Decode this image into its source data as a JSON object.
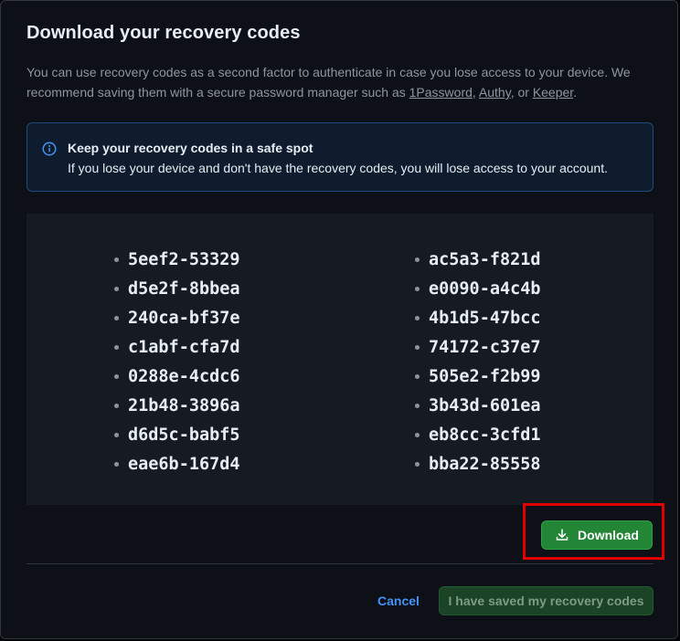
{
  "dialog": {
    "title": "Download your recovery codes",
    "description_part1": "You can use recovery codes as a second factor to authenticate in case you lose access to your device. We recommend saving them with a secure password manager such as ",
    "links": [
      "1Password",
      "Authy",
      "Keeper"
    ],
    "sep1": ", ",
    "sep2": ", or ",
    "end": "."
  },
  "flash": {
    "icon": "info-icon",
    "title": "Keep your recovery codes in a safe spot",
    "text": "If you lose your device and don't have the recovery codes, you will lose access to your account."
  },
  "codes": {
    "left": [
      "5eef2-53329",
      "d5e2f-8bbea",
      "240ca-bf37e",
      "c1abf-cfa7d",
      "0288e-4cdc6",
      "21b48-3896a",
      "d6d5c-babf5",
      "eae6b-167d4"
    ],
    "right": [
      "ac5a3-f821d",
      "e0090-a4c4b",
      "4b1d5-47bcc",
      "74172-c37e7",
      "505e2-f2b99",
      "3b43d-601ea",
      "eb8cc-3cfd1",
      "bba22-85558"
    ]
  },
  "actions": {
    "download_label": "Download",
    "download_icon": "download-icon",
    "cancel_label": "Cancel",
    "saved_label": "I have saved my recovery codes"
  },
  "colors": {
    "accent_blue": "#4493f8",
    "primary_green": "#238636",
    "highlight_red": "#e00000"
  }
}
